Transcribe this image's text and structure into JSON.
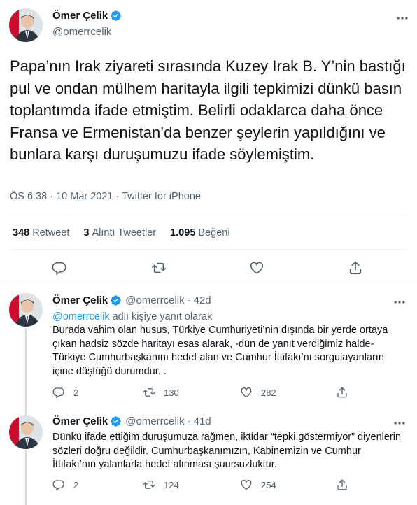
{
  "main_tweet": {
    "author_name": "Ömer Çelik",
    "author_handle": "@omerrcelik",
    "text": "Papa’nın Irak ziyareti sırasında Kuzey Irak B. Y’nin bastığı pul ve ondan mülhem haritayla ilgili tepkimizi dünkü basın toplantımda ifade etmiştim. Belirli odaklarca daha önce Fransa ve Ermenistan’da benzer şeylerin yapıldığını ve bunlara karşı duruşumuzu ifade söylemiştim.",
    "meta": "ÖS 6:38 · 10 Mar 2021 · Twitter for iPhone",
    "stats": {
      "retweets_count": "348",
      "retweets_label": "Retweet",
      "quotes_count": "3",
      "quotes_label": "Alıntı Tweetler",
      "likes_count": "1.095",
      "likes_label": "Beğeni"
    }
  },
  "replies": [
    {
      "author_name": "Ömer Çelik",
      "author_handle": "@omerrcelik",
      "time": "42d",
      "replying_mention": "@omerrcelik",
      "replying_suffix": " adlı kişiye yanıt olarak",
      "text": "Burada vahim olan husus, Türkiye Cumhuriyeti’nin dışında bir yerde ortaya çıkan hadsiz sözde haritayı esas alarak, -dün de yanıt verdiğimiz halde- Türkiye Cumhurbaşkanını hedef alan ve Cumhur İttifakı’nı sorgulayanların içine düştüğü durumdur. .",
      "replies": "2",
      "retweets": "130",
      "likes": "282"
    },
    {
      "author_name": "Ömer Çelik",
      "author_handle": "@omerrcelik",
      "time": "41d",
      "text": "Dünkü ifade ettiğim duruşumuza rağmen, iktidar “tepki göstermiyor” diyenlerin sözleri doğru değildir. Cumhurbaşkanımızın, Kabinemizin ve Cumhur İttifakı’nın yalanlarla hedef alınması şuursuzluktur.",
      "replies": "2",
      "retweets": "124",
      "likes": "254"
    }
  ],
  "colors": {
    "accent": "#1d9bf0",
    "secondary_text": "#536471",
    "divider": "#eff3f4"
  },
  "icons": [
    "verified-badge-icon",
    "more-icon",
    "reply-icon",
    "retweet-icon",
    "like-icon",
    "share-icon"
  ]
}
